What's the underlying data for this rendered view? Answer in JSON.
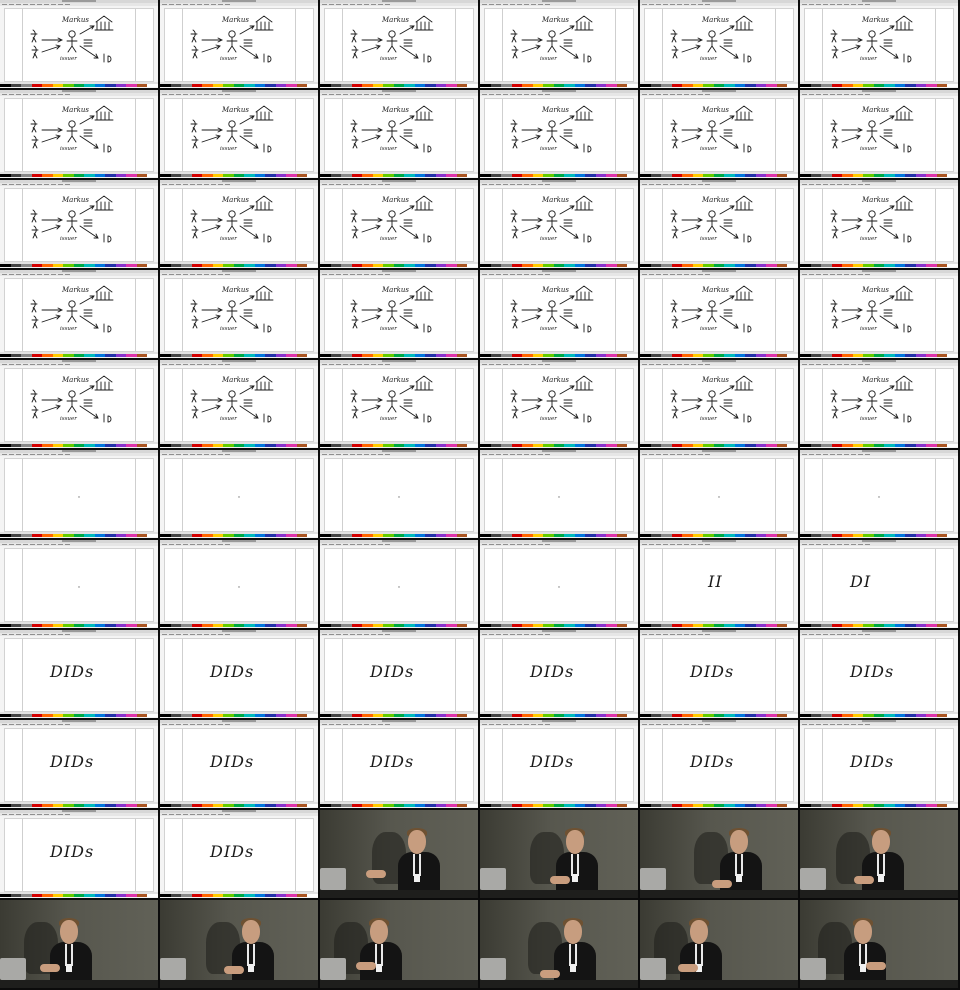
{
  "sheet": {
    "columns": 6,
    "rows": 11,
    "tiles": [
      {
        "kind": "app",
        "drawing": "diagram"
      },
      {
        "kind": "app",
        "drawing": "diagram"
      },
      {
        "kind": "app",
        "drawing": "diagram"
      },
      {
        "kind": "app",
        "drawing": "diagram"
      },
      {
        "kind": "app",
        "drawing": "diagram"
      },
      {
        "kind": "app",
        "drawing": "diagram"
      },
      {
        "kind": "app",
        "drawing": "diagram"
      },
      {
        "kind": "app",
        "drawing": "diagram"
      },
      {
        "kind": "app",
        "drawing": "diagram"
      },
      {
        "kind": "app",
        "drawing": "diagram"
      },
      {
        "kind": "app",
        "drawing": "diagram"
      },
      {
        "kind": "app",
        "drawing": "diagram"
      },
      {
        "kind": "app",
        "drawing": "diagram"
      },
      {
        "kind": "app",
        "drawing": "diagram"
      },
      {
        "kind": "app",
        "drawing": "diagram"
      },
      {
        "kind": "app",
        "drawing": "diagram"
      },
      {
        "kind": "app",
        "drawing": "diagram"
      },
      {
        "kind": "app",
        "drawing": "diagram"
      },
      {
        "kind": "app",
        "drawing": "diagram"
      },
      {
        "kind": "app",
        "drawing": "diagram"
      },
      {
        "kind": "app",
        "drawing": "diagram"
      },
      {
        "kind": "app",
        "drawing": "diagram"
      },
      {
        "kind": "app",
        "drawing": "diagram"
      },
      {
        "kind": "app",
        "drawing": "diagram"
      },
      {
        "kind": "app",
        "drawing": "diagram"
      },
      {
        "kind": "app",
        "drawing": "diagram"
      },
      {
        "kind": "app",
        "drawing": "diagram"
      },
      {
        "kind": "app",
        "drawing": "diagram"
      },
      {
        "kind": "app",
        "drawing": "diagram"
      },
      {
        "kind": "app",
        "drawing": "diagram"
      },
      {
        "kind": "app",
        "drawing": "dot"
      },
      {
        "kind": "app",
        "drawing": "dot"
      },
      {
        "kind": "app",
        "drawing": "dot"
      },
      {
        "kind": "app",
        "drawing": "dot"
      },
      {
        "kind": "app",
        "drawing": "dot"
      },
      {
        "kind": "app",
        "drawing": "dot"
      },
      {
        "kind": "app",
        "drawing": "dot"
      },
      {
        "kind": "app",
        "drawing": "dot"
      },
      {
        "kind": "app",
        "drawing": "dot"
      },
      {
        "kind": "app",
        "drawing": "dot"
      },
      {
        "kind": "app",
        "drawing": "ink",
        "ink_text": "II"
      },
      {
        "kind": "app",
        "drawing": "ink",
        "ink_text": "DI"
      },
      {
        "kind": "app",
        "drawing": "ink",
        "ink_text": "DIDs"
      },
      {
        "kind": "app",
        "drawing": "ink",
        "ink_text": "DIDs"
      },
      {
        "kind": "app",
        "drawing": "ink",
        "ink_text": "DIDs"
      },
      {
        "kind": "app",
        "drawing": "ink",
        "ink_text": "DIDs"
      },
      {
        "kind": "app",
        "drawing": "ink",
        "ink_text": "DIDs"
      },
      {
        "kind": "app",
        "drawing": "ink",
        "ink_text": "DIDs"
      },
      {
        "kind": "app",
        "drawing": "ink",
        "ink_text": "DIDs"
      },
      {
        "kind": "app",
        "drawing": "ink",
        "ink_text": "DIDs"
      },
      {
        "kind": "app",
        "drawing": "ink",
        "ink_text": "DIDs"
      },
      {
        "kind": "app",
        "drawing": "ink",
        "ink_text": "DIDs"
      },
      {
        "kind": "app",
        "drawing": "ink",
        "ink_text": "DIDs"
      },
      {
        "kind": "app",
        "drawing": "ink",
        "ink_text": "DIDs"
      },
      {
        "kind": "app",
        "drawing": "ink",
        "ink_text": "DIDs"
      },
      {
        "kind": "app",
        "drawing": "ink",
        "ink_text": "DIDs"
      },
      {
        "kind": "camera"
      },
      {
        "kind": "camera"
      },
      {
        "kind": "camera"
      },
      {
        "kind": "camera"
      },
      {
        "kind": "camera"
      },
      {
        "kind": "camera"
      },
      {
        "kind": "camera"
      },
      {
        "kind": "camera"
      },
      {
        "kind": "camera"
      },
      {
        "kind": "camera"
      }
    ]
  },
  "diagram": {
    "label_top": "Markus",
    "label_bottom": "issuer"
  },
  "palette_colors": [
    "#000000",
    "#444444",
    "#888888",
    "#d40000",
    "#ff6600",
    "#ffcc00",
    "#66cc00",
    "#00aa44",
    "#00bbbb",
    "#0077dd",
    "#2233aa",
    "#8833cc",
    "#dd33aa",
    "#aa5522",
    "#ffffff"
  ],
  "colors": {
    "canvas": "#ffffff",
    "ink": "#1a1a1a",
    "chrome": "#e6e6e6"
  }
}
